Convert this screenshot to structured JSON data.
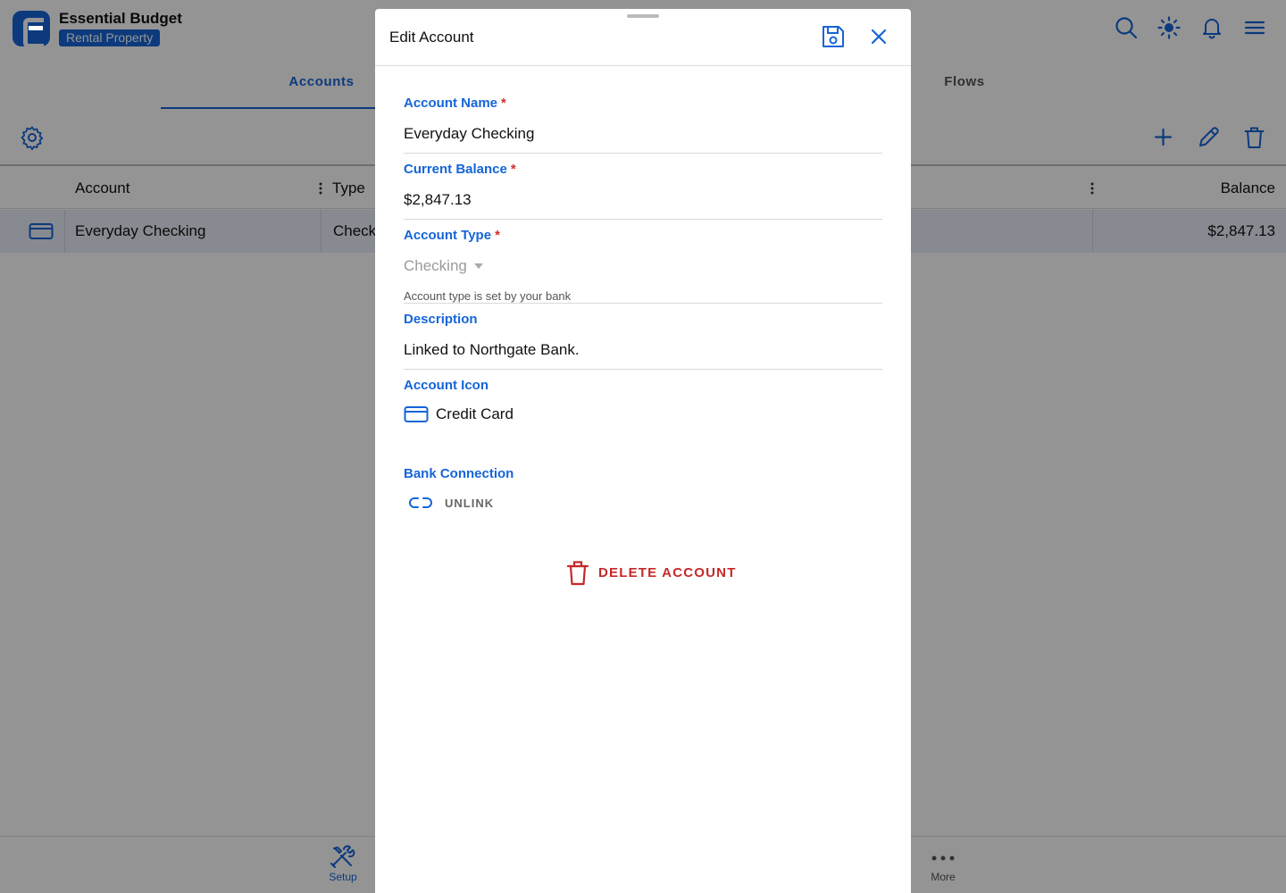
{
  "app": {
    "title": "Essential Budget",
    "badge": "Rental Property",
    "tabs": {
      "accounts": "Accounts",
      "flows": "Flows"
    }
  },
  "grid": {
    "headers": {
      "account": "Account",
      "type": "Type",
      "balance": "Balance"
    },
    "rows": [
      {
        "account": "Everyday Checking",
        "type": "Check",
        "balance": "$2,847.13"
      }
    ]
  },
  "bottom_nav": {
    "setup": "Setup",
    "more": "More"
  },
  "modal": {
    "title": "Edit Account",
    "fields": {
      "account_name": {
        "label": "Account Name",
        "required": "*",
        "value": "Everyday Checking"
      },
      "current_balance": {
        "label": "Current Balance",
        "required": "*",
        "value": "$2,847.13"
      },
      "account_type": {
        "label": "Account Type",
        "required": "*",
        "value": "Checking",
        "hint": "Account type is set by your bank"
      },
      "description": {
        "label": "Description",
        "value": "Linked to Northgate Bank."
      },
      "account_icon": {
        "label": "Account Icon",
        "value": "Credit Card"
      },
      "bank_connection": {
        "label": "Bank Connection",
        "action": "UNLINK"
      }
    },
    "delete_label": "DELETE ACCOUNT"
  },
  "colors": {
    "accent": "#1565d8",
    "danger": "#c62828",
    "required": "#d32f2f"
  }
}
